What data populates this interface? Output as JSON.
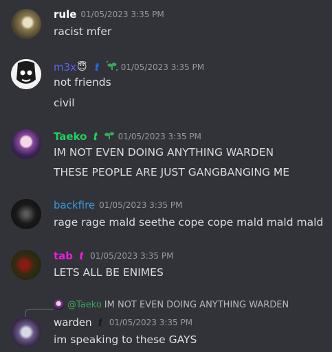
{
  "messages": [
    {
      "username": "rule",
      "timestamp": "01/05/2023 3:35 PM",
      "color": "#ffffff",
      "lines": [
        "racist mfer"
      ]
    },
    {
      "username": "m3x",
      "timestamp": "01/05/2023 3:35 PM",
      "color": "#5865f2",
      "lines": [
        "not friends",
        "civil"
      ]
    },
    {
      "username": "Taeko",
      "timestamp": "01/05/2023 3:35 PM",
      "color": "#23d160",
      "lines": [
        "IM NOT EVEN DOING ANYTHING WARDEN",
        "THESE PEOPLE ARE JUST GANGBANGING ME"
      ]
    },
    {
      "username": "backfire",
      "timestamp": "01/05/2023 3:35 PM",
      "color": "#3498db",
      "lines": [
        "rage rage mald seethe cope cope mald mald mald"
      ]
    },
    {
      "username": "tab",
      "timestamp": "01/05/2023 3:35 PM",
      "color": "#e91edc",
      "lines": [
        "LETS ALL BE ENIMES"
      ]
    },
    {
      "username": "warden",
      "timestamp": "01/05/2023 3:35 PM",
      "color": "#e3e5e8",
      "lines": [
        "im speaking to these GAYS"
      ],
      "reply": {
        "mention": "@Taeko",
        "text": "IM NOT EVEN DOING ANYTHING WARDEN"
      }
    }
  ],
  "icons": {
    "halo_emoji": "😇",
    "role_badge": "𝒕",
    "plant_badge": "❦"
  }
}
